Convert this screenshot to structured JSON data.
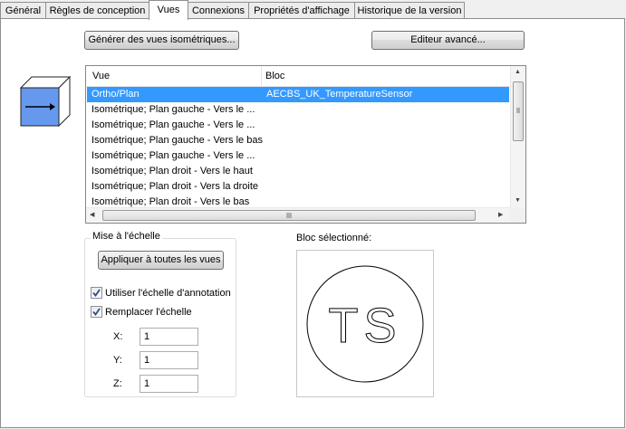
{
  "tabs": [
    {
      "label": "Général",
      "active": false
    },
    {
      "label": "Règles de conception",
      "active": false
    },
    {
      "label": "Vues",
      "active": true
    },
    {
      "label": "Connexions",
      "active": false
    },
    {
      "label": "Propriétés d'affichage",
      "active": false
    },
    {
      "label": "Historique de la version",
      "active": false
    }
  ],
  "buttons": {
    "generate_iso": "Générer des vues isométriques...",
    "advanced_editor": "Editeur avancé...",
    "apply_all": "Appliquer à toutes les vues"
  },
  "view_list": {
    "columns": [
      "Vue",
      "Bloc"
    ],
    "rows": [
      {
        "vue": "Ortho/Plan",
        "bloc": "AECBS_UK_TemperatureSensor",
        "selected": true
      },
      {
        "vue": "Isométrique; Plan gauche - Vers le ...",
        "bloc": "",
        "selected": false
      },
      {
        "vue": "Isométrique; Plan gauche - Vers le ...",
        "bloc": "",
        "selected": false
      },
      {
        "vue": "Isométrique; Plan gauche - Vers le bas",
        "bloc": "",
        "selected": false
      },
      {
        "vue": "Isométrique; Plan gauche - Vers le ...",
        "bloc": "",
        "selected": false
      },
      {
        "vue": "Isométrique; Plan droit - Vers le haut",
        "bloc": "",
        "selected": false
      },
      {
        "vue": "Isométrique; Plan droit - Vers la droite",
        "bloc": "",
        "selected": false
      },
      {
        "vue": "Isométrique; Plan droit - Vers le bas",
        "bloc": "",
        "selected": false
      }
    ]
  },
  "scale_group": {
    "title": "Mise à l'échelle",
    "use_annotation_scale": {
      "label": "Utiliser l'échelle d'annotation",
      "checked": true
    },
    "override_scale": {
      "label": "Remplacer l'échelle",
      "checked": true
    },
    "x": {
      "label": "X:",
      "value": "1"
    },
    "y": {
      "label": "Y:",
      "value": "1"
    },
    "z": {
      "label": "Z:",
      "value": "1"
    }
  },
  "selected_block": {
    "title": "Bloc sélectionné:",
    "symbol_text": "TS"
  },
  "icons": {
    "view_cube": "view-cube-icon",
    "checkmark": "check-icon"
  },
  "colors": {
    "selection": "#3399ff",
    "cube_face": "#6699ee"
  }
}
